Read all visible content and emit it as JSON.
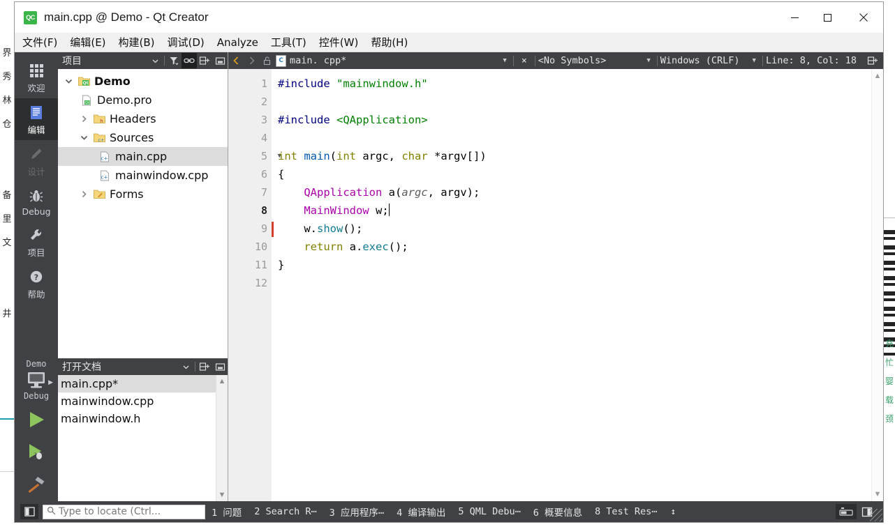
{
  "window": {
    "title": "main.cpp @ Demo - Qt Creator",
    "logo_text": "QC",
    "minimize_label": "最小化",
    "maximize_label": "最大化",
    "close_label": "关闭"
  },
  "menubar": [
    {
      "label": "文件(F)",
      "mnemonic": "F"
    },
    {
      "label": "编辑(E)",
      "mnemonic": "E"
    },
    {
      "label": "构建(B)",
      "mnemonic": "B"
    },
    {
      "label": "调试(D)",
      "mnemonic": "D"
    },
    {
      "label": "Analyze",
      "mnemonic": "A"
    },
    {
      "label": "工具(T)",
      "mnemonic": "T"
    },
    {
      "label": "控件(W)",
      "mnemonic": "W"
    },
    {
      "label": "帮助(H)",
      "mnemonic": "H"
    }
  ],
  "modebar": {
    "items": [
      {
        "label": "欢迎",
        "icon": "grid-icon",
        "state": "normal"
      },
      {
        "label": "编辑",
        "icon": "document-lines-icon",
        "state": "active"
      },
      {
        "label": "设计",
        "icon": "pencil-icon",
        "state": "disabled"
      },
      {
        "label": "Debug",
        "icon": "bug-icon",
        "state": "normal"
      },
      {
        "label": "项目",
        "icon": "wrench-icon",
        "state": "normal"
      },
      {
        "label": "帮助",
        "icon": "question-circle-icon",
        "state": "normal"
      }
    ],
    "kit": {
      "project_name": "Demo",
      "build_config": "Debug",
      "target_icon": "desktop-monitor-icon"
    },
    "actions": [
      {
        "name": "run",
        "icon": "play-triangle-icon"
      },
      {
        "name": "debug",
        "icon": "play-bug-icon"
      },
      {
        "name": "build",
        "icon": "hammer-icon"
      }
    ]
  },
  "projects_dock": {
    "title": "项目",
    "tools": [
      {
        "name": "view-selector",
        "icon": "chevron-down-icon",
        "active": false
      },
      {
        "name": "filter",
        "icon": "filter-icon",
        "active": false
      },
      {
        "name": "synchronize-with-editor",
        "icon": "link-icon",
        "active": true
      },
      {
        "name": "split-add",
        "icon": "split-add-icon",
        "active": false
      },
      {
        "name": "close-dock",
        "icon": "collapse-icon",
        "active": false
      }
    ],
    "tree": [
      {
        "label": "Demo",
        "indent": 0,
        "twisty": "down",
        "icon": "qt-project-folder-icon",
        "bold": true,
        "selected": false
      },
      {
        "label": "Demo.pro",
        "indent": 1,
        "twisty": "none",
        "icon": "qt-pro-file-icon",
        "bold": false,
        "selected": false
      },
      {
        "label": "Headers",
        "indent": 1,
        "twisty": "right",
        "icon": "folder-h-icon",
        "bold": false,
        "selected": false
      },
      {
        "label": "Sources",
        "indent": 1,
        "twisty": "down",
        "icon": "folder-cpp-icon",
        "bold": false,
        "selected": false
      },
      {
        "label": "main.cpp",
        "indent": 2,
        "twisty": "none",
        "icon": "cpp-file-icon",
        "bold": false,
        "selected": true
      },
      {
        "label": "mainwindow.cpp",
        "indent": 2,
        "twisty": "none",
        "icon": "cpp-file-icon",
        "bold": false,
        "selected": false
      },
      {
        "label": "Forms",
        "indent": 1,
        "twisty": "right",
        "icon": "folder-forms-icon",
        "bold": false,
        "selected": false
      }
    ]
  },
  "open_documents_dock": {
    "title": "打开文档",
    "tools": [
      {
        "name": "view-selector",
        "icon": "chevron-down-icon",
        "active": false
      },
      {
        "name": "split-add",
        "icon": "split-add-icon",
        "active": false
      },
      {
        "name": "close-dock",
        "icon": "collapse-icon",
        "active": false
      }
    ],
    "documents": [
      {
        "label": "main.cpp*",
        "selected": true
      },
      {
        "label": "mainwindow.cpp",
        "selected": false
      },
      {
        "label": "mainwindow.h",
        "selected": false
      }
    ]
  },
  "editor_toolbar": {
    "back_label": "返回",
    "forward_label": "前进",
    "lock_label": "只读锁",
    "file_name": "main. cpp*",
    "file_icon_letter": "C",
    "close_label": "×",
    "symbol_selector": "<No Symbols>",
    "line_ending": "Windows (CRLF)",
    "cursor_position": "Line: 8, Col: 18",
    "split_label": "分栏"
  },
  "editor": {
    "line_count": 12,
    "current_line": 8,
    "changed_lines": [
      9
    ],
    "fold_markers": [
      5
    ],
    "lines": [
      {
        "n": 1,
        "tokens": [
          {
            "t": "#include ",
            "c": "k-pre"
          },
          {
            "t": "\"mainwindow.h\"",
            "c": "k-str"
          }
        ]
      },
      {
        "n": 2,
        "tokens": []
      },
      {
        "n": 3,
        "tokens": [
          {
            "t": "#include ",
            "c": "k-pre"
          },
          {
            "t": "<QApplication>",
            "c": "k-str"
          }
        ]
      },
      {
        "n": 4,
        "tokens": []
      },
      {
        "n": 5,
        "tokens": [
          {
            "t": "int ",
            "c": "k-type"
          },
          {
            "t": "main",
            "c": "k-fn"
          },
          {
            "t": "(",
            "c": "k-punc"
          },
          {
            "t": "int ",
            "c": "k-type"
          },
          {
            "t": "argc",
            "c": "k-punc"
          },
          {
            "t": ", ",
            "c": "k-punc"
          },
          {
            "t": "char ",
            "c": "k-type"
          },
          {
            "t": "*argv[])",
            "c": "k-punc"
          }
        ]
      },
      {
        "n": 6,
        "tokens": [
          {
            "t": "{",
            "c": "k-punc"
          }
        ]
      },
      {
        "n": 7,
        "tokens": [
          {
            "t": "    ",
            "c": "k-punc"
          },
          {
            "t": "QApplication",
            "c": "k-class"
          },
          {
            "t": " a(",
            "c": "k-punc"
          },
          {
            "t": "argc",
            "c": "k-param"
          },
          {
            "t": ", argv);",
            "c": "k-punc"
          }
        ]
      },
      {
        "n": 8,
        "tokens": [
          {
            "t": "    ",
            "c": "k-punc"
          },
          {
            "t": "MainWindow",
            "c": "k-class"
          },
          {
            "t": " w;",
            "c": "k-punc"
          }
        ],
        "caret_at_end": true
      },
      {
        "n": 9,
        "tokens": [
          {
            "t": "    w.",
            "c": "k-punc"
          },
          {
            "t": "show",
            "c": "k-meth"
          },
          {
            "t": "();",
            "c": "k-punc"
          }
        ]
      },
      {
        "n": 10,
        "tokens": [
          {
            "t": "    ",
            "c": "k-punc"
          },
          {
            "t": "return ",
            "c": "k-type"
          },
          {
            "t": "a.",
            "c": "k-punc"
          },
          {
            "t": "exec",
            "c": "k-meth"
          },
          {
            "t": "();",
            "c": "k-punc"
          }
        ]
      },
      {
        "n": 11,
        "tokens": [
          {
            "t": "}",
            "c": "k-punc"
          }
        ]
      },
      {
        "n": 12,
        "tokens": []
      }
    ]
  },
  "statusbar": {
    "sidebar_toggle_label": "侧边栏",
    "locator_placeholder": "Type to locate (Ctrl...",
    "locator_value": "",
    "panels": [
      {
        "label": "1 问题"
      },
      {
        "label": "2 Search R⋯"
      },
      {
        "label": "3 应用程序⋯"
      },
      {
        "label": "4 编译输出"
      },
      {
        "label": "5 QML Debu⋯"
      },
      {
        "label": "6 概要信息"
      },
      {
        "label": "8 Test Res⋯"
      }
    ],
    "updown_label": "↕",
    "right_buttons": [
      {
        "name": "progress-details",
        "icon": "progress-bar-icon",
        "active": true
      },
      {
        "name": "toggle-side-panel",
        "icon": "panel-split-icon",
        "active": false
      }
    ]
  },
  "colors": {
    "dark_chrome": "#3f4144",
    "dark_chrome_active": "#2c2e30",
    "selection": "#dcdcdc",
    "accent_green": "#3bb54a",
    "change_marker": "#d43f2e",
    "editor_bg": "#ffffff",
    "gutter_bg": "#efefef"
  },
  "background": {
    "left_text": "界\n秀\n林\n仓\n\n\n备\n里\n文\n\n\n井",
    "right_text": "充\n忙\n婴\n载\n颈"
  }
}
